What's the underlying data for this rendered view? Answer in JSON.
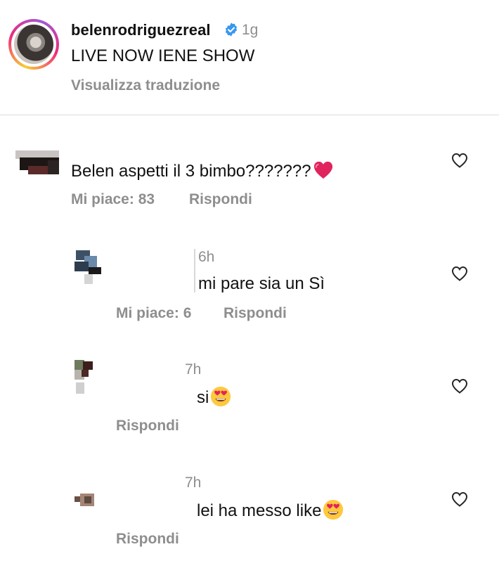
{
  "post": {
    "username": "belenrodriguezreal",
    "time": "1g",
    "caption": "LIVE NOW IENE SHOW",
    "translate_label": "Visualizza traduzione"
  },
  "comments": [
    {
      "text": "Belen aspetti il 3 bimbo???????",
      "emoji": "red-heart",
      "likes_label": "Mi piace: 83",
      "reply_label": "Rispondi"
    }
  ],
  "replies": [
    {
      "time": "6h",
      "text": "mi pare sia un Sì",
      "likes_label": "Mi piace: 6",
      "reply_label": "Rispondi"
    },
    {
      "time": "7h",
      "text": "si",
      "emoji": "heart-eyes",
      "reply_label": "Rispondi"
    },
    {
      "time": "7h",
      "text": "lei ha messo like",
      "emoji": "heart-eyes",
      "reply_label": "Rispondi"
    }
  ],
  "colors": {
    "verified": "#3897f0",
    "muted": "#8e8e8e",
    "heart_emoji": "#e0245e",
    "emoji_face": "#ffc83d"
  }
}
